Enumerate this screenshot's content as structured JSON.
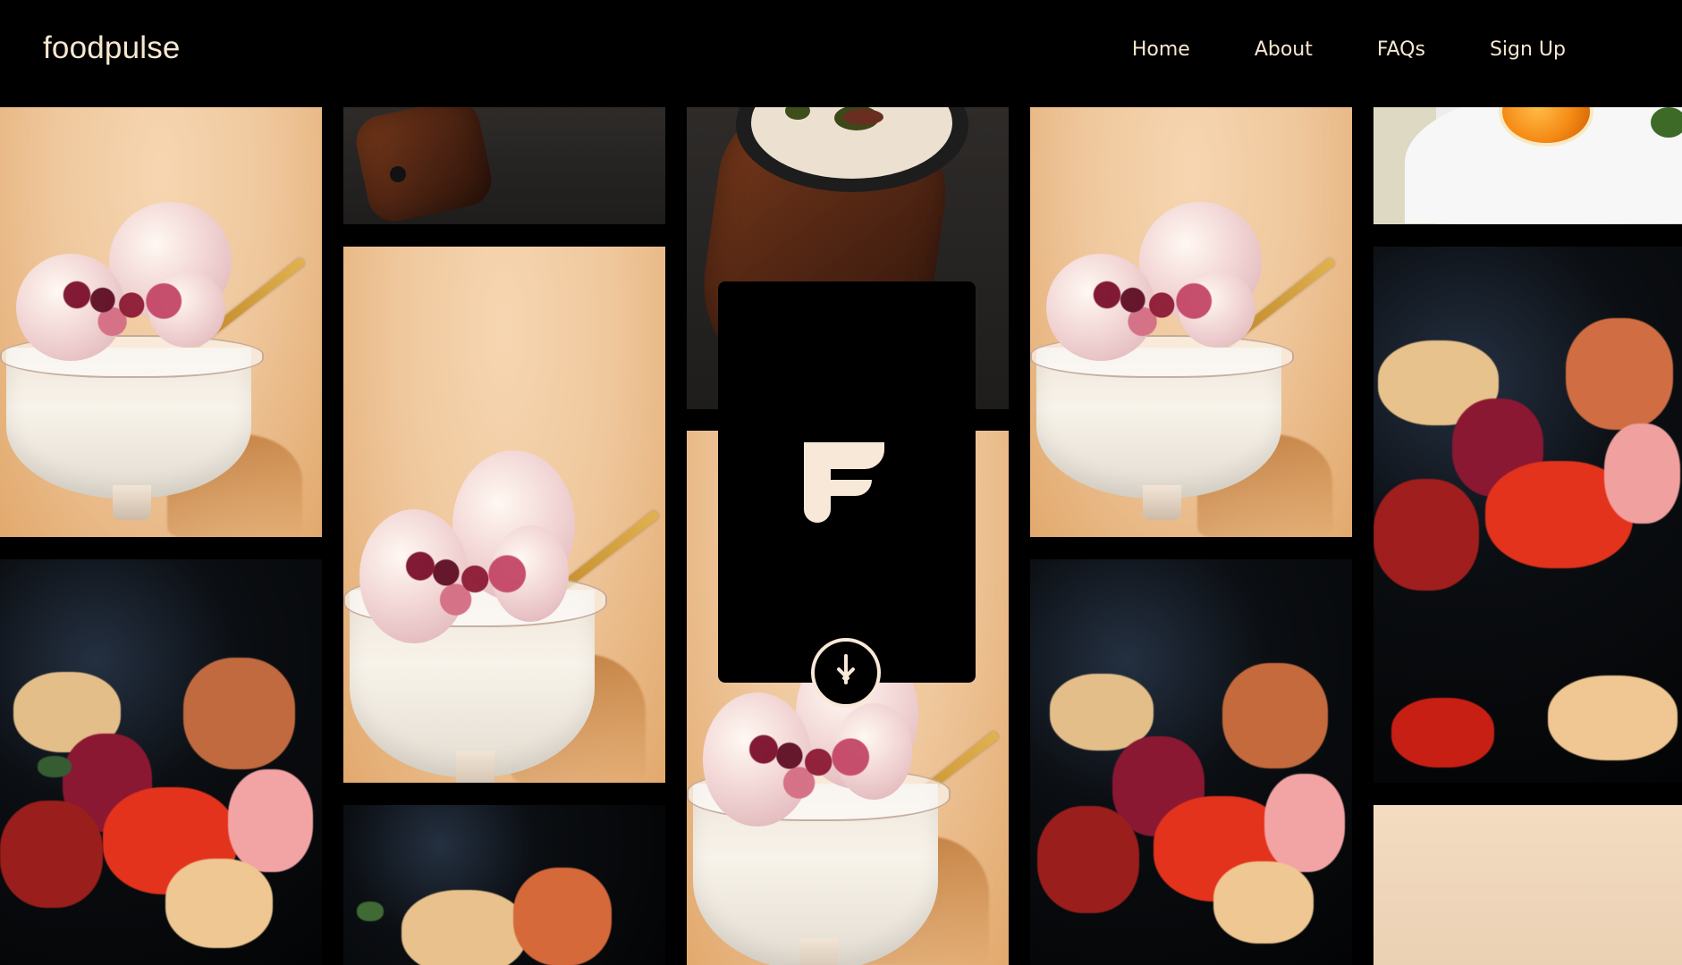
{
  "header": {
    "brand": "foodpulse",
    "nav": [
      {
        "label": "Home"
      },
      {
        "label": "About"
      },
      {
        "label": "FAQs"
      },
      {
        "label": "Sign Up"
      }
    ]
  },
  "modal": {
    "logo_icon": "foodpulse-logo-icon",
    "scroll_icon": "arrow-down-icon"
  },
  "colors": {
    "background": "#000000",
    "accent": "#f8e8d7"
  }
}
